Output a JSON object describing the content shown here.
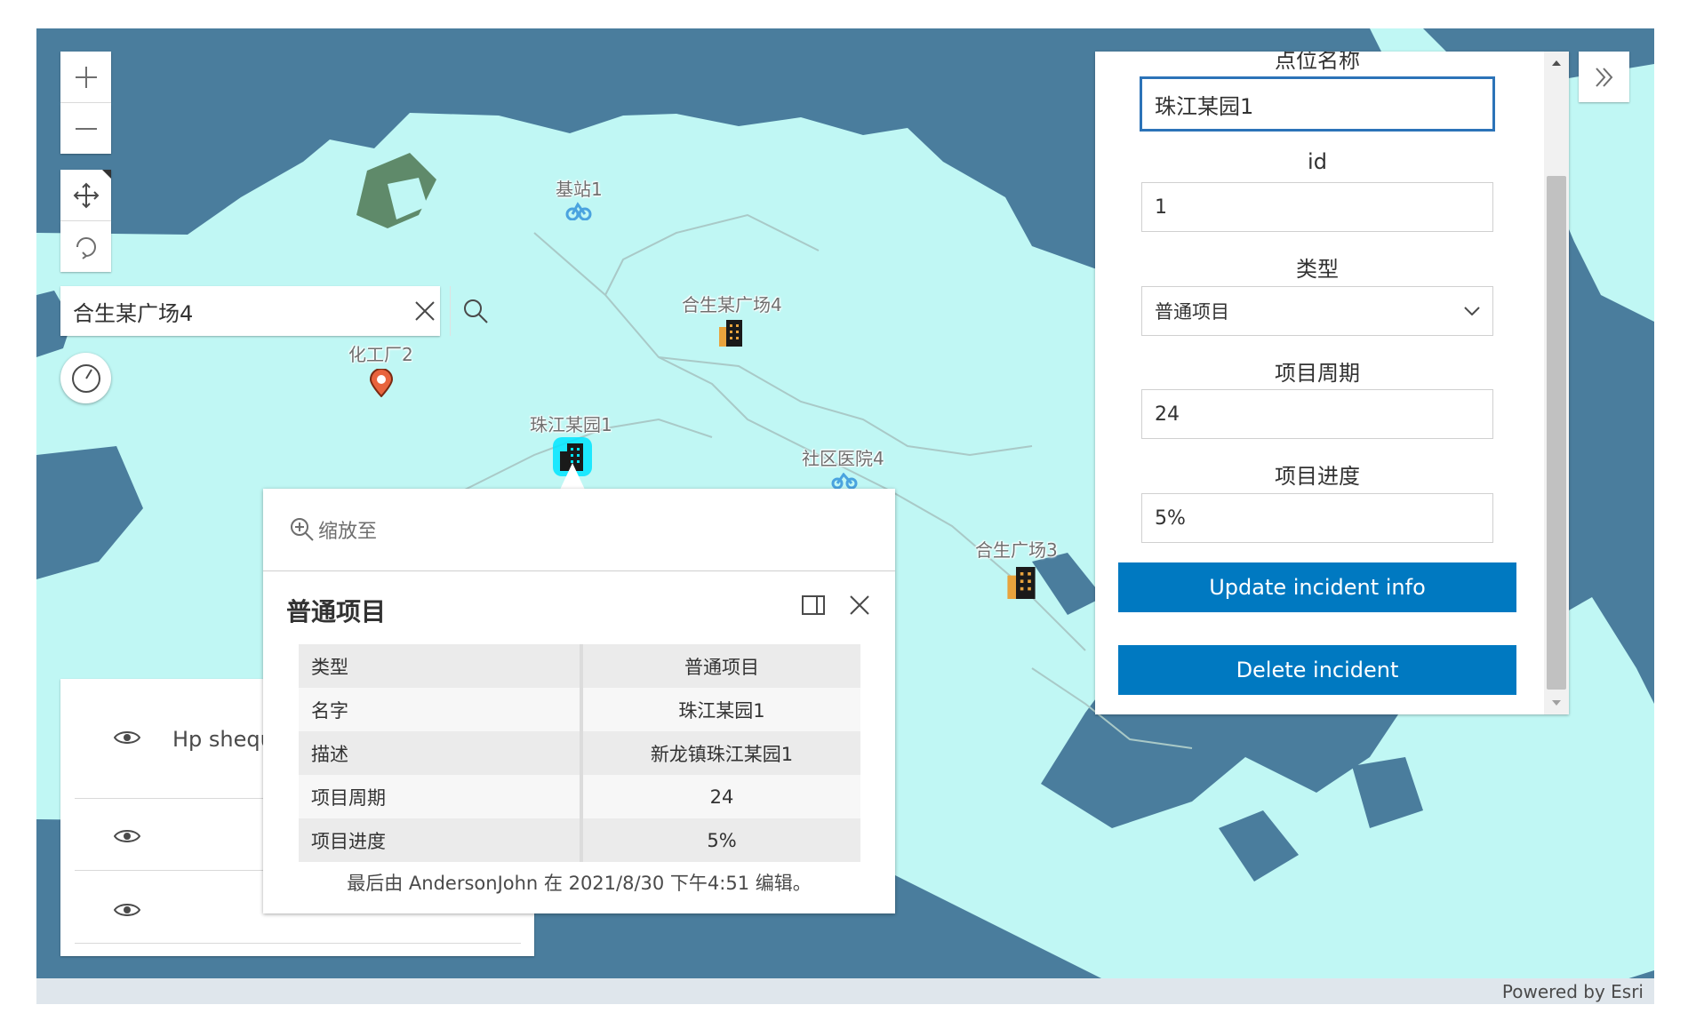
{
  "colors": {
    "water": "#4a7d9d",
    "land": "#c0f7f4",
    "accent": "#0079c1",
    "focus": "#2c73b8"
  },
  "map": {
    "labels": {
      "station1": "基站1",
      "square4": "合生某广场4",
      "factory2": "化工厂2",
      "garden1": "珠江某园1",
      "hospital4": "社区医院4",
      "square3": "合生广场3"
    },
    "icons": {
      "zoom_in": "plus-icon",
      "zoom_out": "minus-icon",
      "pan": "move-icon",
      "rotate": "rotate-icon",
      "compass": "compass-icon",
      "expand": "double-chevron-right-icon"
    },
    "attribution": "Powered by Esri"
  },
  "search": {
    "value": "合生某广场4"
  },
  "layer_list": {
    "items": [
      {
        "title": "Hp shequ :"
      },
      {
        "title": ""
      },
      {
        "title": ""
      }
    ]
  },
  "popup": {
    "zoom_label": "缩放至",
    "title": "普通项目",
    "rows": [
      {
        "key": "类型",
        "value": "普通项目"
      },
      {
        "key": "名字",
        "value": "珠江某园1"
      },
      {
        "key": "描述",
        "value": "新龙镇珠江某园1"
      },
      {
        "key": "项目周期",
        "value": "24"
      },
      {
        "key": "项目进度",
        "value": "5%"
      }
    ],
    "footer": "最后由 AndersonJohn 在 2021/8/30 下午4:51 编辑。"
  },
  "editor": {
    "name_label": "点位名称",
    "name_value": "珠江某园1",
    "id_label": "id",
    "id_value": "1",
    "type_label": "类型",
    "type_value": "普通项目",
    "period_label": "项目周期",
    "period_value": "24",
    "progress_label": "项目进度",
    "progress_value": "5%",
    "update_label": "Update incident info",
    "delete_label": "Delete incident"
  }
}
